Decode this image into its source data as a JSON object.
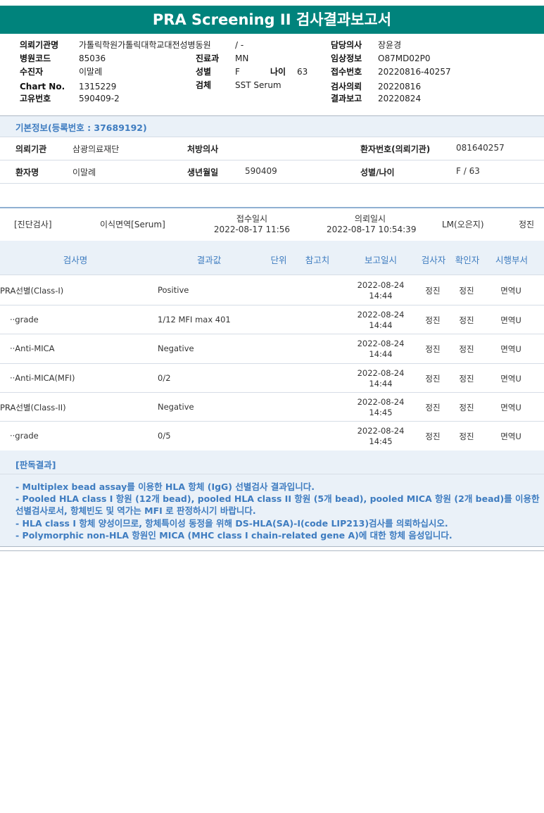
{
  "title": "PRA Screening II 검사결과보고서",
  "header": {
    "requester_label": "의뢰기관명",
    "requester_value": "가톨릭학원가톨릭대학교대전성병동원",
    "hospital_code_label": "병원코드",
    "hospital_code_value": "85036",
    "examinee_label": "수진자",
    "examinee_value": "이말례",
    "chart_no_label": "Chart No.",
    "chart_no_value": "1315229",
    "unique_no_label": "고유번호",
    "unique_no_value": "590409-2",
    "ward_value": "/ -",
    "dept_label": "진료과",
    "dept_value": "MN",
    "sex_label": "성별",
    "sex_value": "F",
    "age_label": "나이",
    "age_value": "63",
    "specimen_label": "검체",
    "specimen_value": "SST Serum",
    "doctor_label": "담당의사",
    "doctor_value": "장윤경",
    "clinical_label": "임상정보",
    "clinical_value": "O87MD02P0",
    "receipt_label": "접수번호",
    "receipt_value": "20220816-40257",
    "req_date_label": "검사의뢰",
    "req_date_value": "20220816",
    "report_label": "결과보고",
    "report_value": "20220824"
  },
  "basic": {
    "title": "기본정보(등록번호 : 37689192)",
    "inst_label": "의뢰기관",
    "inst_value": "삼광의료재단",
    "prescriber_label": "처방의사",
    "prescriber_value": "",
    "pt_no_label": "환자번호(의뢰기관)",
    "pt_no_value": "081640257",
    "name_label": "환자명",
    "name_value": "이말례",
    "dob_label": "생년월일",
    "dob_value": "590409",
    "sexage_label": "성별/나이",
    "sexage_value": "F / 63"
  },
  "diagnosis": {
    "category": "[진단검사]",
    "specimen": "이식면역[Serum]",
    "receipt_label": "접수일시",
    "receipt_value": "2022-08-17  11:56",
    "request_label": "의뢰일시",
    "request_value": "2022-08-17  10:54:39",
    "location": "LM(오은지)",
    "person": "정진"
  },
  "table": {
    "headers": [
      "검사명",
      "결과값",
      "단위",
      "참고치",
      "보고일시",
      "검사자",
      "확인자",
      "시행부서"
    ],
    "rows": [
      {
        "name": "PRA선별(Class-I)",
        "result": "Positive",
        "date": "2022-08-24",
        "time": "14:44",
        "tester": "정진",
        "checker": "정진",
        "dept": "면역U"
      },
      {
        "name": "··grade",
        "result": "1/12 MFI max 401",
        "date": "2022-08-24",
        "time": "14:44",
        "tester": "정진",
        "checker": "정진",
        "dept": "면역U"
      },
      {
        "name": "··Anti-MICA",
        "result": "Negative",
        "date": "2022-08-24",
        "time": "14:44",
        "tester": "정진",
        "checker": "정진",
        "dept": "면역U"
      },
      {
        "name": "··Anti-MICA(MFI)",
        "result": "0/2",
        "date": "2022-08-24",
        "time": "14:44",
        "tester": "정진",
        "checker": "정진",
        "dept": "면역U"
      },
      {
        "name": "PRA선별(Class-II)",
        "result": "Negative",
        "date": "2022-08-24",
        "time": "14:45",
        "tester": "정진",
        "checker": "정진",
        "dept": "면역U"
      },
      {
        "name": "··grade",
        "result": "0/5",
        "date": "2022-08-24",
        "time": "14:45",
        "tester": "정진",
        "checker": "정진",
        "dept": "면역U"
      }
    ]
  },
  "interpretation": {
    "title": "[판독결과]",
    "lines": [
      "- Multiplex bead assay를 이용한 HLA 항체 (IgG) 선별검사 결과입니다.",
      "- Pooled HLA class I 항원 (12개 bead), pooled HLA class II 항원 (5개 bead), pooled MICA 항원 (2개 bead)를 이용한 선별검사로서, 항체빈도 및 역가는 MFI 로 판정하시기 바랍니다.",
      "- HLA class I 항체 양성이므로, 항체특이성 동정을 위해 DS-HLA(SA)-I(code LIP213)검사를 의뢰하십시오.",
      "- Polymorphic non-HLA 항원인 MICA (MHC class I chain-related gene A)에 대한 항체 음성입니다."
    ]
  }
}
